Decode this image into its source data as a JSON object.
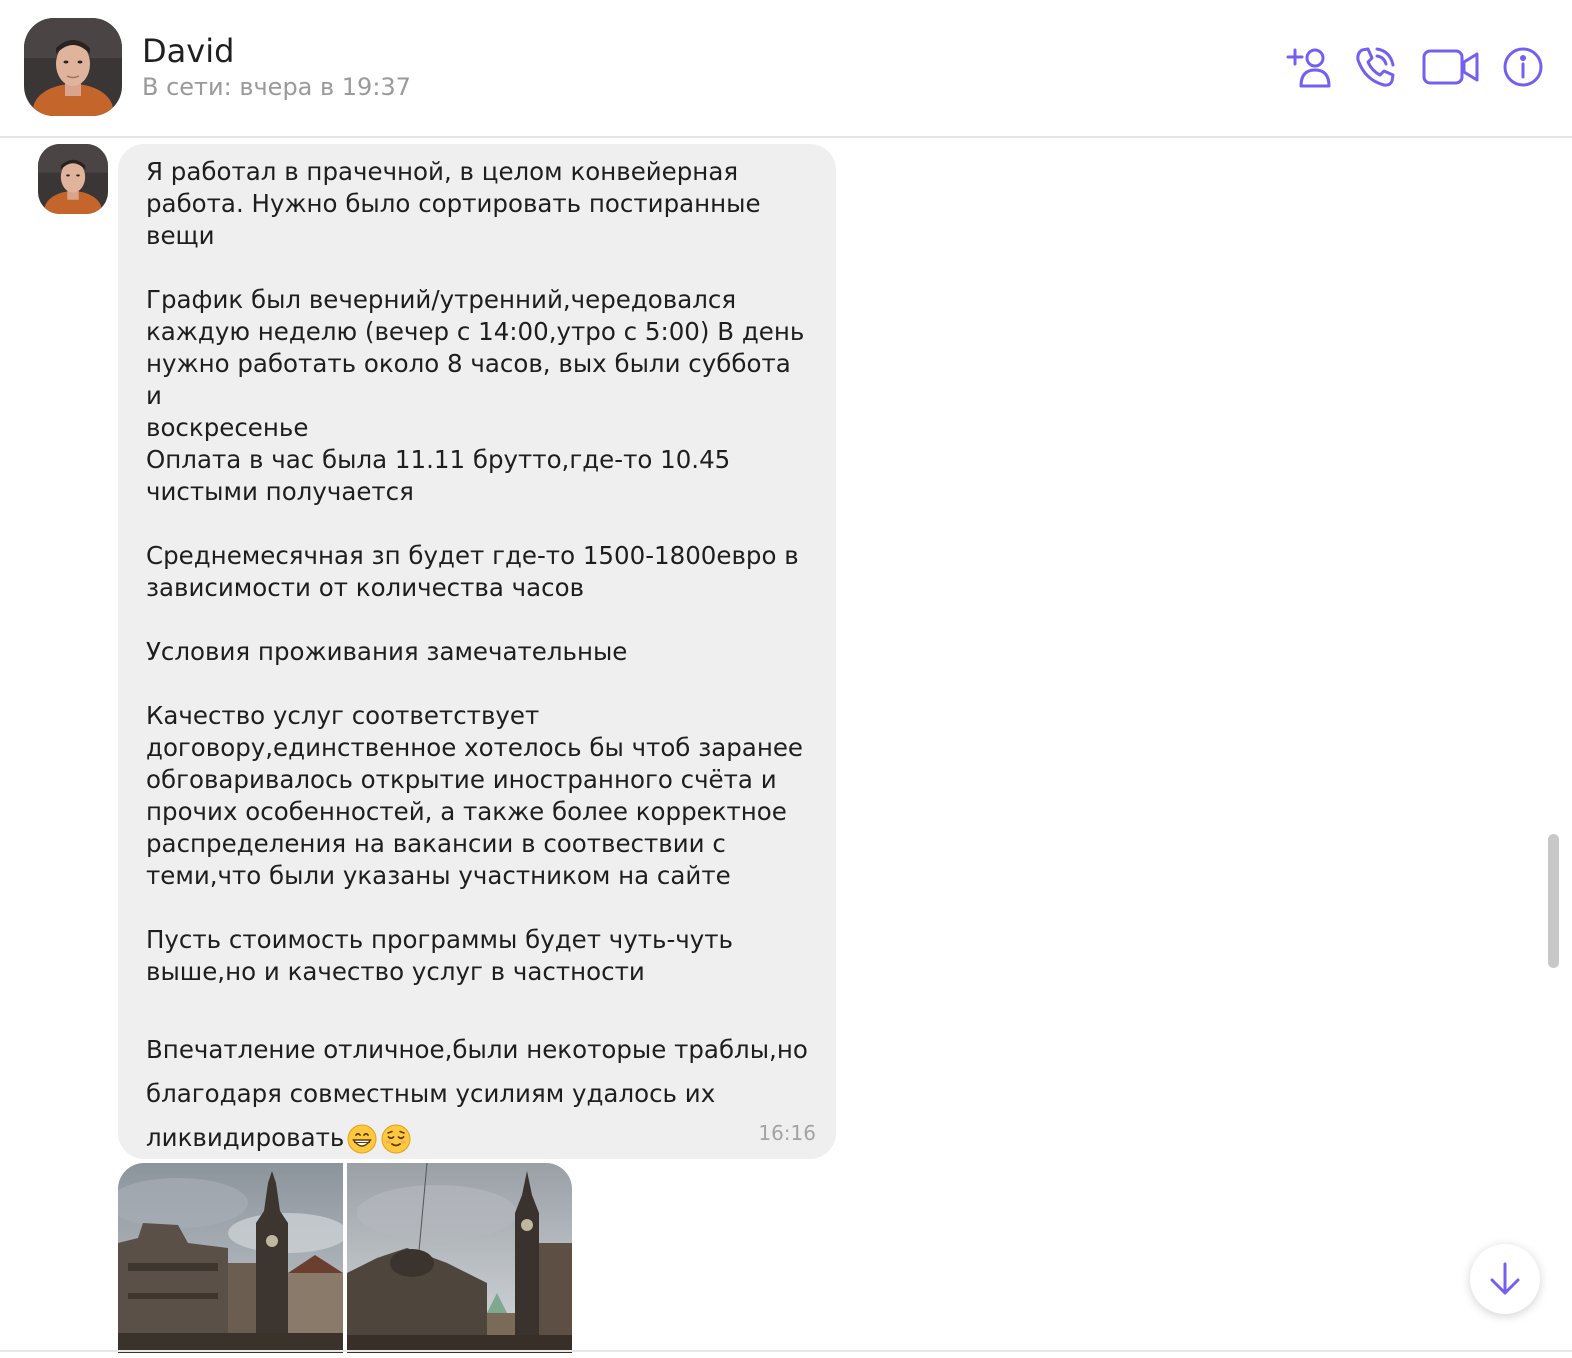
{
  "header": {
    "name": "David",
    "status": "В сети: вчера в 19:37",
    "icons": [
      "add-contact-icon",
      "phone-call-icon",
      "video-call-icon",
      "info-icon"
    ],
    "accent_color": "#7360f2"
  },
  "message": {
    "lines": {
      "p1": [
        "Я работал в прачечной, в целом конвейерная",
        "работа. Нужно было сортировать постиранные",
        "вещи"
      ],
      "p2": [
        "График был вечерний/утренний,чередовался",
        "каждую неделю (вечер с 14:00,утро с 5:00) В день",
        "нужно работать около 8 часов, вых были суббота и",
        "воскресенье",
        "Оплата в час была 11.11 брутто,где-то 10.45",
        "чистыми получается"
      ],
      "p3": [
        "Среднемесячная зп будет где-то 1500-1800евро в",
        "зависимости от количества часов"
      ],
      "p4": [
        "Условия проживания замечательные"
      ],
      "p5": [
        "Качество услуг соответствует",
        "договору,единственное хотелось бы чтоб заранее",
        "обговаривалось открытие иностранного счёта и",
        "прочих особенностей, а также более корректное",
        "распределения на вакансии в соотвествии с",
        "теми,что были указаны участником на сайте"
      ],
      "p6": [
        "Пусть стоимость программы будет чуть-чуть",
        "выше,но и качество услуг в частности"
      ],
      "p7": [
        "Впечатление отличное,были некоторые траблы,но",
        "благодаря совместным усилиям удалось их",
        "ликвидировать"
      ]
    },
    "emojis": [
      "grinning-face-emoji",
      "relieved-face-emoji"
    ],
    "time": "16:16",
    "bubble_color": "#efefef"
  },
  "photos": [
    "dresden-cathedral-photo-1",
    "dresden-cathedral-photo-2"
  ]
}
